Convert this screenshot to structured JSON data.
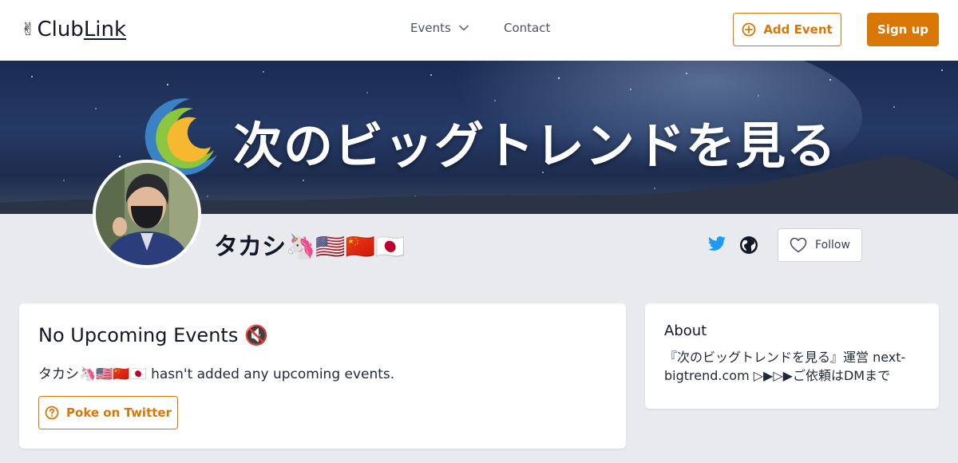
{
  "header": {
    "logo_hand": "✌",
    "logo_club": "Club",
    "logo_link": "Link",
    "nav": {
      "events_label": "Events",
      "contact_label": "Contact"
    },
    "add_event_label": "Add Event",
    "signup_label": "Sign up"
  },
  "banner": {
    "title": "次のビッグトレンドを見る"
  },
  "profile": {
    "name": "タカシ🦄🇺🇸🇨🇳🇯🇵",
    "follow_label": "Follow"
  },
  "events": {
    "heading": "No Upcoming Events 🔇",
    "message": "タカシ🦄🇺🇸🇨🇳🇯🇵 hasn't added any upcoming events.",
    "poke_label": "Poke on Twitter"
  },
  "about": {
    "heading": "About",
    "text": "『次のビッグトレンドを見る』運営 next-bigtrend.com ▷▶▷▶ご依頼はDMまで"
  },
  "colors": {
    "accent": "#d97706",
    "twitter": "#1d9bf0",
    "page_bg": "#e8eaee"
  },
  "icons": {
    "nav_chevron": "chevron-down-icon",
    "add_event": "plus-circle-icon",
    "twitter": "twitter-icon",
    "website": "globe-icon",
    "follow": "heart-icon",
    "poke": "question-circle-icon"
  }
}
